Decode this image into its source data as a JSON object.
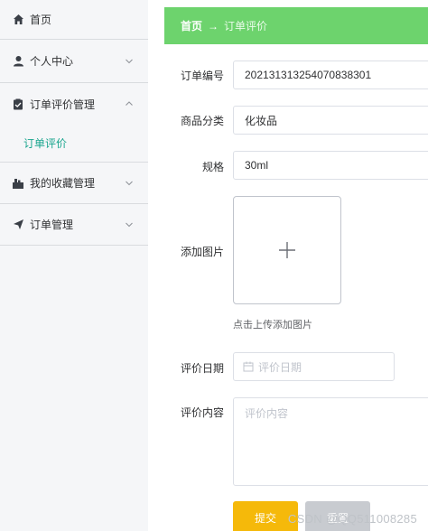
{
  "sidebar": {
    "items": [
      {
        "label": "首页",
        "icon": "home-icon"
      },
      {
        "label": "个人中心",
        "icon": "user-icon"
      },
      {
        "label": "订单评价管理",
        "icon": "clipboard-icon",
        "expanded": true,
        "children": [
          {
            "label": "订单评价"
          }
        ]
      },
      {
        "label": "我的收藏管理",
        "icon": "collection-icon"
      },
      {
        "label": "订单管理",
        "icon": "send-icon"
      }
    ]
  },
  "breadcrumb": {
    "home": "首页",
    "separator": "→",
    "current": "订单评价"
  },
  "form": {
    "order_no": {
      "label": "订单编号",
      "value": "20213131325407083830​1"
    },
    "category": {
      "label": "商品分类",
      "value": "化妆品"
    },
    "spec": {
      "label": "规格",
      "value": "30ml"
    },
    "image": {
      "label": "添加图片",
      "hint": "点击上传添加图片"
    },
    "date": {
      "label": "评价日期",
      "placeholder": "评价日期"
    },
    "content": {
      "label": "评价内容",
      "placeholder": "评价内容"
    },
    "submit_label": "提交",
    "reset_label": "重置"
  },
  "watermark": "CSDN @QQ511008285",
  "colors": {
    "accent": "#6dd36d",
    "active_text": "#1aa58e",
    "submit": "#f5b90a",
    "reset": "#c8cbd0"
  }
}
